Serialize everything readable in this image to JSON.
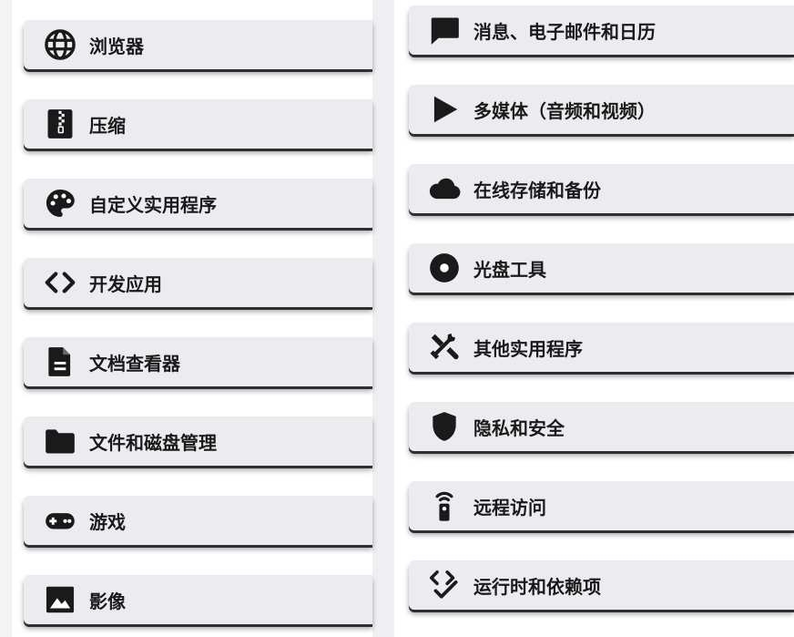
{
  "left_categories": [
    {
      "label": "浏览器",
      "icon": "globe-icon"
    },
    {
      "label": "压缩",
      "icon": "zip-file-icon"
    },
    {
      "label": "自定义实用程序",
      "icon": "palette-icon"
    },
    {
      "label": "开发应用",
      "icon": "code-brackets-icon"
    },
    {
      "label": "文档查看器",
      "icon": "document-icon"
    },
    {
      "label": "文件和磁盘管理",
      "icon": "folder-icon"
    },
    {
      "label": "游戏",
      "icon": "gamepad-icon"
    },
    {
      "label": "影像",
      "icon": "image-icon"
    }
  ],
  "right_categories": [
    {
      "label": "消息、电子邮件和日历",
      "icon": "chat-bubble-icon"
    },
    {
      "label": "多媒体（音频和视频）",
      "icon": "play-icon"
    },
    {
      "label": "在线存储和备份",
      "icon": "cloud-icon"
    },
    {
      "label": "光盘工具",
      "icon": "disc-icon"
    },
    {
      "label": "其他实用程序",
      "icon": "tools-icon"
    },
    {
      "label": "隐私和安全",
      "icon": "shield-icon"
    },
    {
      "label": "远程访问",
      "icon": "remote-control-icon"
    },
    {
      "label": "运行时和依赖项",
      "icon": "code-check-icon"
    }
  ],
  "colors": {
    "icon": "#1a1a1a",
    "card": "#ececf0",
    "text": "#1a1a1a"
  }
}
